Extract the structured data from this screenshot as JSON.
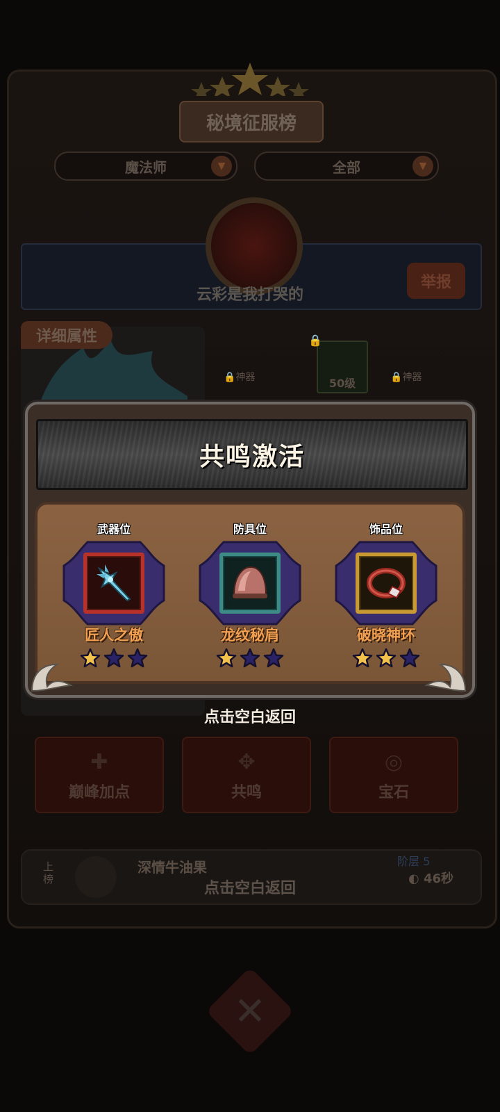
{
  "background": {
    "ranking_title": "秘境征服榜",
    "class_filter": "魔法师",
    "scope_filter": "全部",
    "player_name": "云彩是我打哭的",
    "report_label": "举报",
    "detail_tab": "详细属性",
    "slot_tags": [
      "神器",
      "神器"
    ],
    "level_badge": "50级",
    "bottom_buttons": [
      {
        "label": "巅峰加点",
        "icon": "plus-icon"
      },
      {
        "label": "共鸣",
        "icon": "resonance-icon"
      },
      {
        "label": "宝石",
        "icon": "gem-icon"
      }
    ],
    "rank_row": {
      "rank_label": "上榜",
      "name": "深情牛油果",
      "tier": "阶层 5",
      "time": "46秒"
    },
    "hint_bottom": "点击空白返回"
  },
  "popup": {
    "title": "共鸣激活",
    "slots": [
      {
        "label": "武器位",
        "item": "匠人之傲",
        "stars_filled": 1,
        "stars_total": 3,
        "frame_color": "#b8322a",
        "icon": "dagger-icon"
      },
      {
        "label": "防具位",
        "item": "龙纹秘肩",
        "stars_filled": 1,
        "stars_total": 3,
        "frame_color": "#3d8a86",
        "icon": "shoulder-armor-icon"
      },
      {
        "label": "饰品位",
        "item": "破晓神环",
        "stars_filled": 2,
        "stars_total": 3,
        "frame_color": "#c99a34",
        "icon": "bracelet-icon"
      }
    ],
    "hint": "点击空白返回"
  },
  "colors": {
    "star_filled": "#f2c14a",
    "star_empty": "#2a2466",
    "item_name": "#f2a152"
  }
}
